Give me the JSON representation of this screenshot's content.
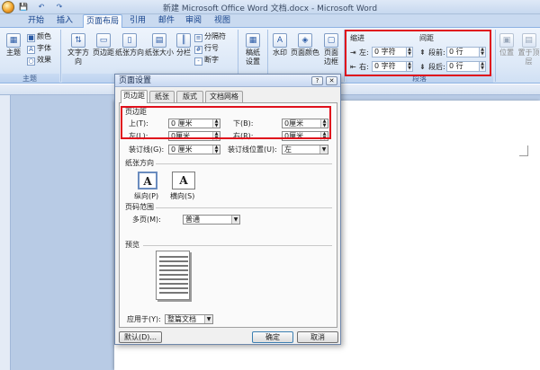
{
  "window": {
    "title": "新建 Microsoft Office Word 文档.docx - Microsoft Word"
  },
  "quick_access": {
    "save": "💾",
    "undo": "↶",
    "redo": "↷"
  },
  "tabs": [
    "开始",
    "插入",
    "页面布局",
    "引用",
    "邮件",
    "审阅",
    "视图"
  ],
  "ribbon": {
    "theme": {
      "big": "主题",
      "colors": "颜色",
      "fonts": "字体",
      "effects": "效果",
      "group": "主题"
    },
    "setup": {
      "text_dir": "文字方向",
      "margins": "页边距",
      "orientation": "纸张方向",
      "size": "纸张大小",
      "columns": "分栏",
      "breaks": "分隔符",
      "line_numbers": "行号",
      "hyphenation": "断字",
      "group": "页面设置"
    },
    "manuscript": {
      "label1": "稿纸",
      "label2": "设置"
    },
    "background": {
      "watermark": "水印",
      "page_color": "页面颜色",
      "page_border1": "页面",
      "page_border2": "边框"
    },
    "indent": {
      "title": "缩进",
      "left_label": "左:",
      "left_value": "0 字符",
      "right_label": "右:",
      "right_value": "0 字符"
    },
    "spacing": {
      "title": "间距",
      "before_label": "段前:",
      "before_value": "0 行",
      "after_label": "段后:",
      "after_value": "0 行"
    },
    "paragraph_group": "段落",
    "arrange": {
      "position": "位置",
      "bring_front": "置于顶层"
    }
  },
  "dialog": {
    "title": "页面设置",
    "help": "?",
    "close": "✕",
    "tabs": [
      "页边距",
      "纸张",
      "版式",
      "文档网格"
    ],
    "margins": {
      "section": "页边距",
      "top_label": "上(T):",
      "top_value": "0 厘米",
      "bottom_label": "下(B):",
      "bottom_value": "0厘米",
      "left_label": "左(L):",
      "left_value": "0厘米",
      "right_label": "右(R):",
      "right_value": "0厘米",
      "gutter_label": "装订线(G):",
      "gutter_value": "0 厘米",
      "gutter_pos_label": "装订线位置(U):",
      "gutter_pos_value": "左"
    },
    "orientation": {
      "section": "纸张方向",
      "portrait": "纵向(P)",
      "landscape": "横向(S)",
      "glyph": "A"
    },
    "pages": {
      "section": "页码范围",
      "multiple_label": "多页(M):",
      "multiple_value": "普通"
    },
    "preview": {
      "section": "预览"
    },
    "apply": {
      "label": "应用于(Y):",
      "value": "整篇文档"
    },
    "buttons": {
      "default": "默认(D)...",
      "ok": "确定",
      "cancel": "取消"
    }
  },
  "highlight_color": "#e0101c"
}
